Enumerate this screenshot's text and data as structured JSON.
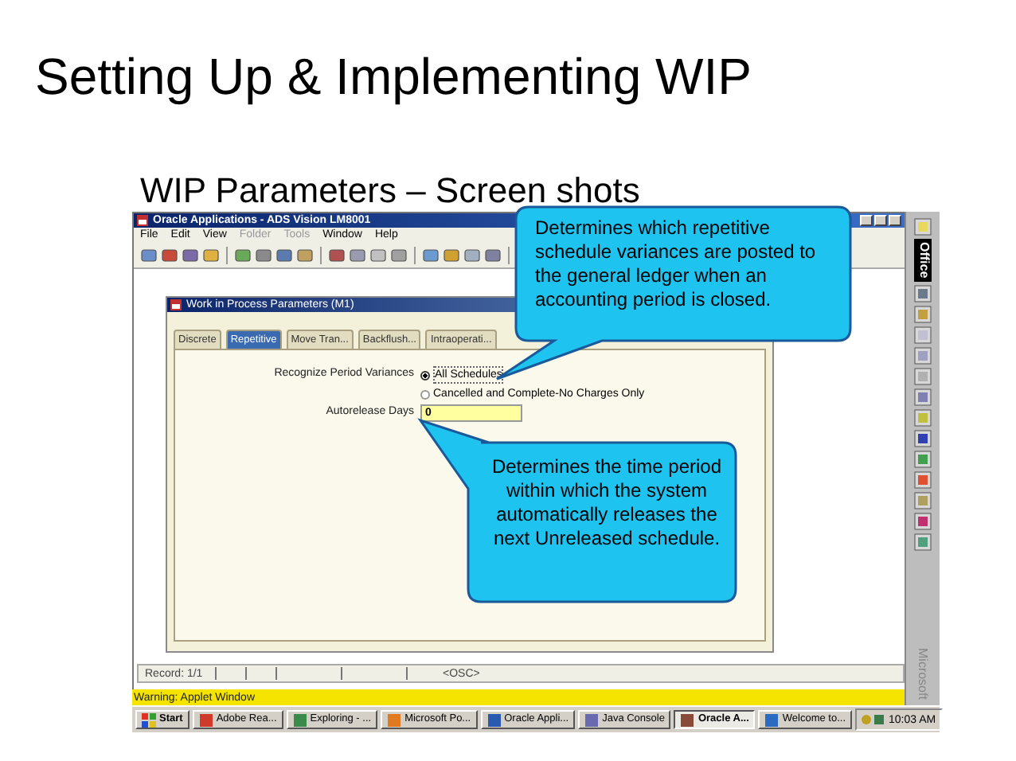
{
  "slide": {
    "title": "Setting Up & Implementing WIP",
    "subtitle": "WIP Parameters – Screen shots"
  },
  "app_window": {
    "title": "Oracle Applications - ADS Vision LM8001",
    "menu": [
      {
        "label": "File",
        "disabled": false
      },
      {
        "label": "Edit",
        "disabled": false
      },
      {
        "label": "View",
        "disabled": false
      },
      {
        "label": "Folder",
        "disabled": true
      },
      {
        "label": "Tools",
        "disabled": true
      },
      {
        "label": "Window",
        "disabled": false
      },
      {
        "label": "Help",
        "disabled": false
      }
    ],
    "form": {
      "title": "Work in Process Parameters (M1)",
      "tabs": [
        {
          "label": "Discrete",
          "selected": false
        },
        {
          "label": "Repetitive",
          "selected": true
        },
        {
          "label": "Move Tran...",
          "selected": false
        },
        {
          "label": "Backflush...",
          "selected": false
        },
        {
          "label": "Intraoperati...",
          "selected": false
        }
      ],
      "fields": [
        {
          "kind": "radio",
          "label": "Recognize Period Variances",
          "options": [
            {
              "label": "All Schedules",
              "selected": true
            },
            {
              "label": "Cancelled and Complete-No Charges Only",
              "selected": false
            }
          ]
        },
        {
          "kind": "text",
          "label": "Autorelease Days",
          "value": "0"
        }
      ]
    },
    "status_bar": [
      "Record: 1/1",
      "<OSC>"
    ],
    "warning_bar": "Warning: Applet Window"
  },
  "taskbar": {
    "start": "Start",
    "items": [
      {
        "label": "Adobe Rea...",
        "selected": false
      },
      {
        "label": "Exploring - ...",
        "selected": false
      },
      {
        "label": "Microsoft Po...",
        "selected": false
      },
      {
        "label": "Oracle Appli...",
        "selected": false
      },
      {
        "label": "Java Console",
        "selected": false
      },
      {
        "label": "Oracle A...",
        "selected": true
      },
      {
        "label": "Welcome to...",
        "selected": false
      }
    ],
    "clock": "10:03 AM"
  },
  "office_bar": {
    "title": "Office",
    "footer": "Microsoft"
  },
  "callouts": [
    {
      "text": "Determines which repetitive schedule variances are posted to the general ledger when an accounting period is closed."
    },
    {
      "text": "Determines the time period within which the system automatically releases the next Unreleased schedule."
    }
  ]
}
